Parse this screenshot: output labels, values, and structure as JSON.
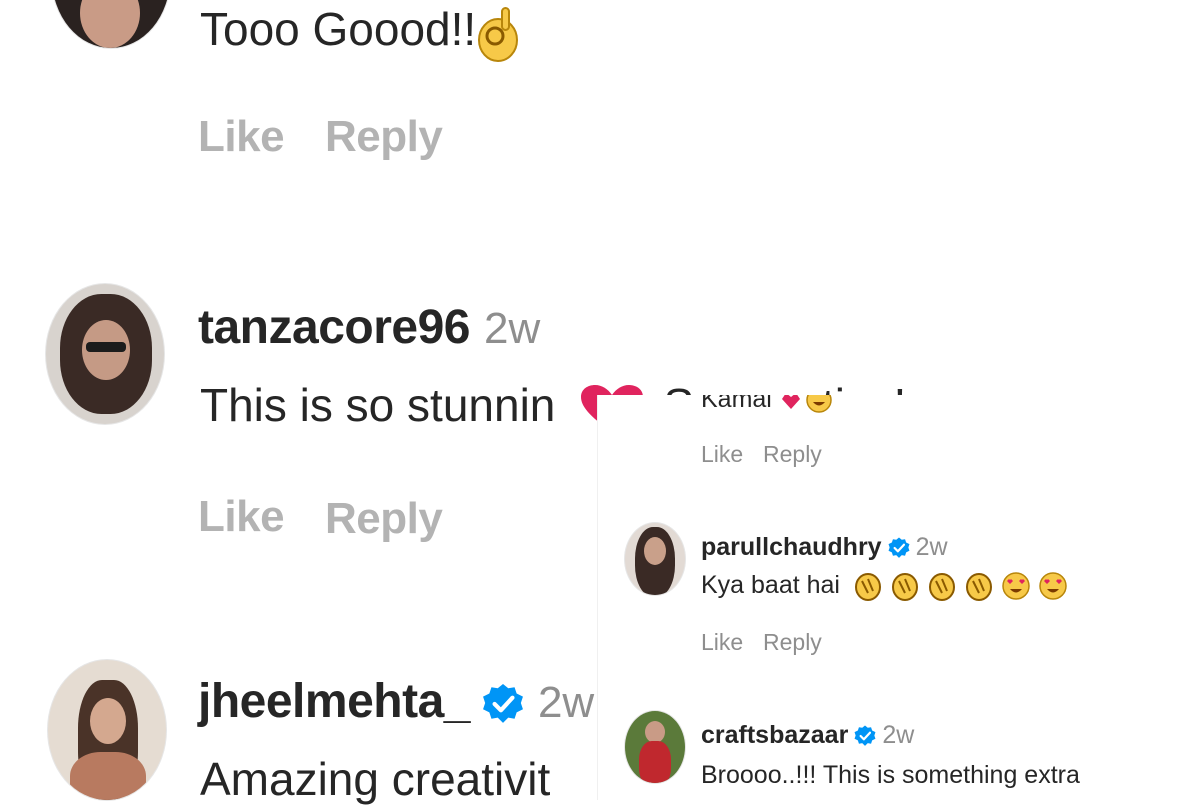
{
  "left_comments": {
    "comment1": {
      "text": "Tooo Goood!!",
      "emoji": "ok-hand-emoji"
    },
    "comment1_actions": {
      "like": "Like",
      "reply": "Reply"
    },
    "comment2": {
      "username": "tanzacore96",
      "time": "2w",
      "text": "This is so stunnin",
      "emoji": "red-heart-emoji",
      "text_after": "So creative!"
    },
    "comment2_actions": {
      "like": "Like",
      "reply": "Reply"
    },
    "comment3": {
      "username": "jheelmehta_",
      "time": "2w",
      "verified_icon": "verified-badge-icon",
      "text": "Amazing creativit"
    }
  },
  "right_panel": {
    "top_comment": {
      "text": "Kamal",
      "emojis": [
        "red-heart-emoji",
        "grinning-face-emoji"
      ]
    },
    "top_actions": {
      "like": "Like",
      "reply": "Reply"
    },
    "comment1": {
      "username": "parullchaudhry",
      "verified_icon": "verified-badge-icon",
      "time": "2w",
      "text": "Kya baat hai",
      "emojis": [
        "clapping-hands-emoji",
        "clapping-hands-emoji",
        "clapping-hands-emoji",
        "clapping-hands-emoji",
        "heart-eyes-emoji",
        "heart-eyes-emoji"
      ]
    },
    "comment1_actions": {
      "like": "Like",
      "reply": "Reply"
    },
    "comment2": {
      "username": "craftsbazaar",
      "verified_icon": "verified-badge-icon",
      "time": "2w",
      "text": "Broooo..!!! This is something extra"
    }
  },
  "colors": {
    "text": "#262626",
    "secondary": "#8e8e8e",
    "action_light": "#b3b3b3",
    "verified_blue": "#0095f6",
    "heart_red": "#e0245e",
    "emoji_yellow": "#f7c948"
  }
}
